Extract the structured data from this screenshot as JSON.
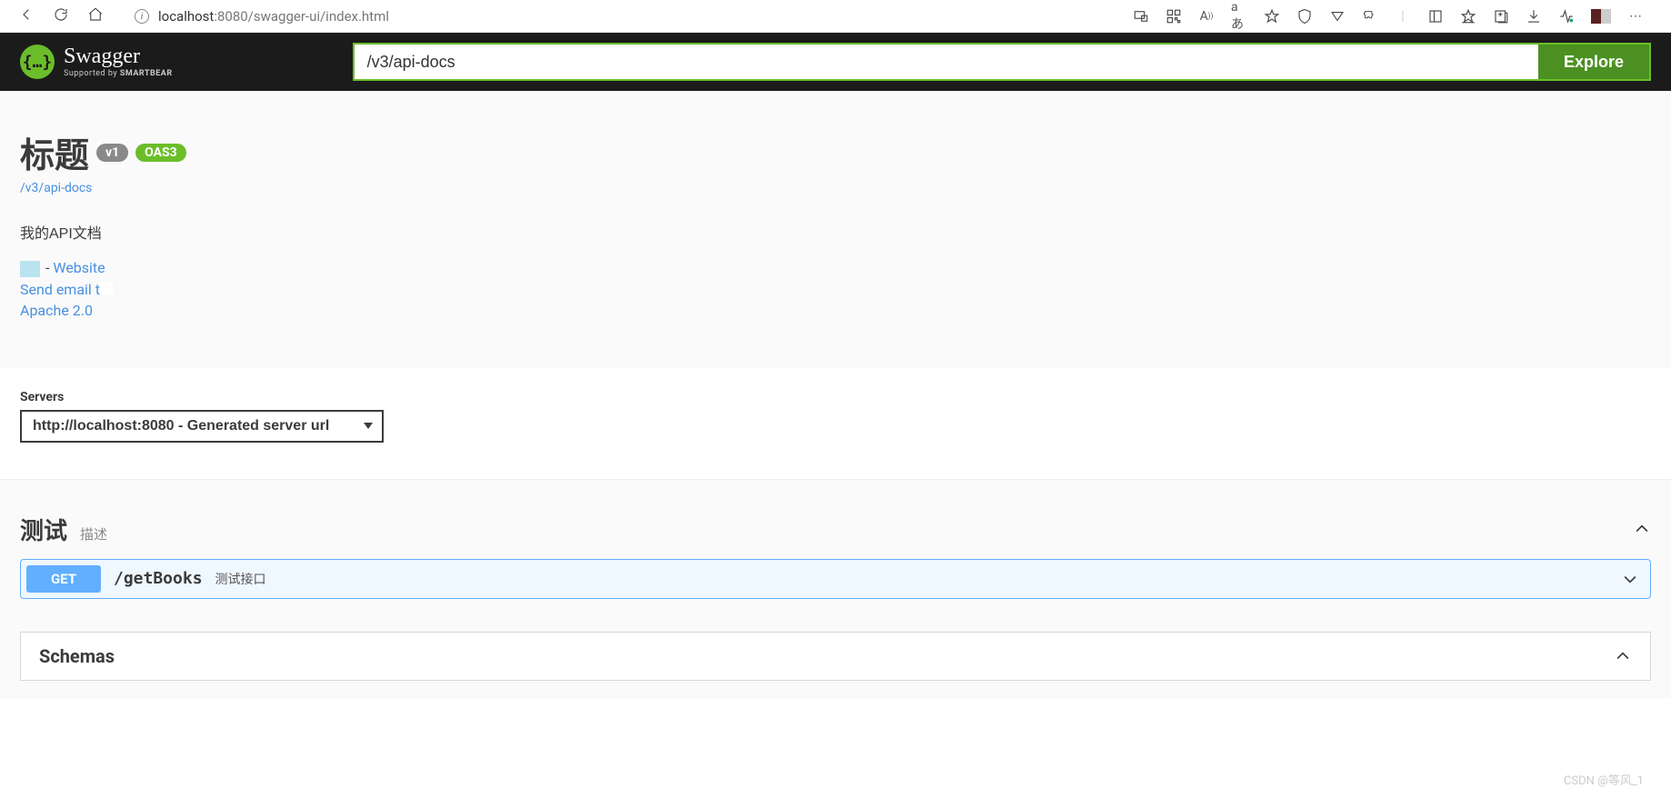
{
  "browser": {
    "url_host": "localhost",
    "url_port_path": ":8080/swagger-ui/index.html"
  },
  "topbar": {
    "logo_main": "Swagger",
    "logo_sub_prefix": "Supported by ",
    "logo_sub_bold": "SMARTBEAR",
    "search_value": "/v3/api-docs",
    "explore_label": "Explore"
  },
  "info": {
    "title": "标题",
    "version_badge": "v1",
    "oas_badge": "OAS3",
    "docs_url_label": "/v3/api-docs",
    "description": "我的API文档",
    "website_prefix": " - ",
    "website_label": "Website",
    "email_label": "Send email t",
    "license_label": "Apache 2.0"
  },
  "servers": {
    "label": "Servers",
    "selected": "http://localhost:8080 - Generated server url"
  },
  "tag": {
    "name": "测试",
    "desc": "描述"
  },
  "operation": {
    "method": "GET",
    "path": "/getBooks",
    "summary": "测试接口"
  },
  "schemas": {
    "title": "Schemas"
  },
  "watermark": "CSDN @等风_1"
}
